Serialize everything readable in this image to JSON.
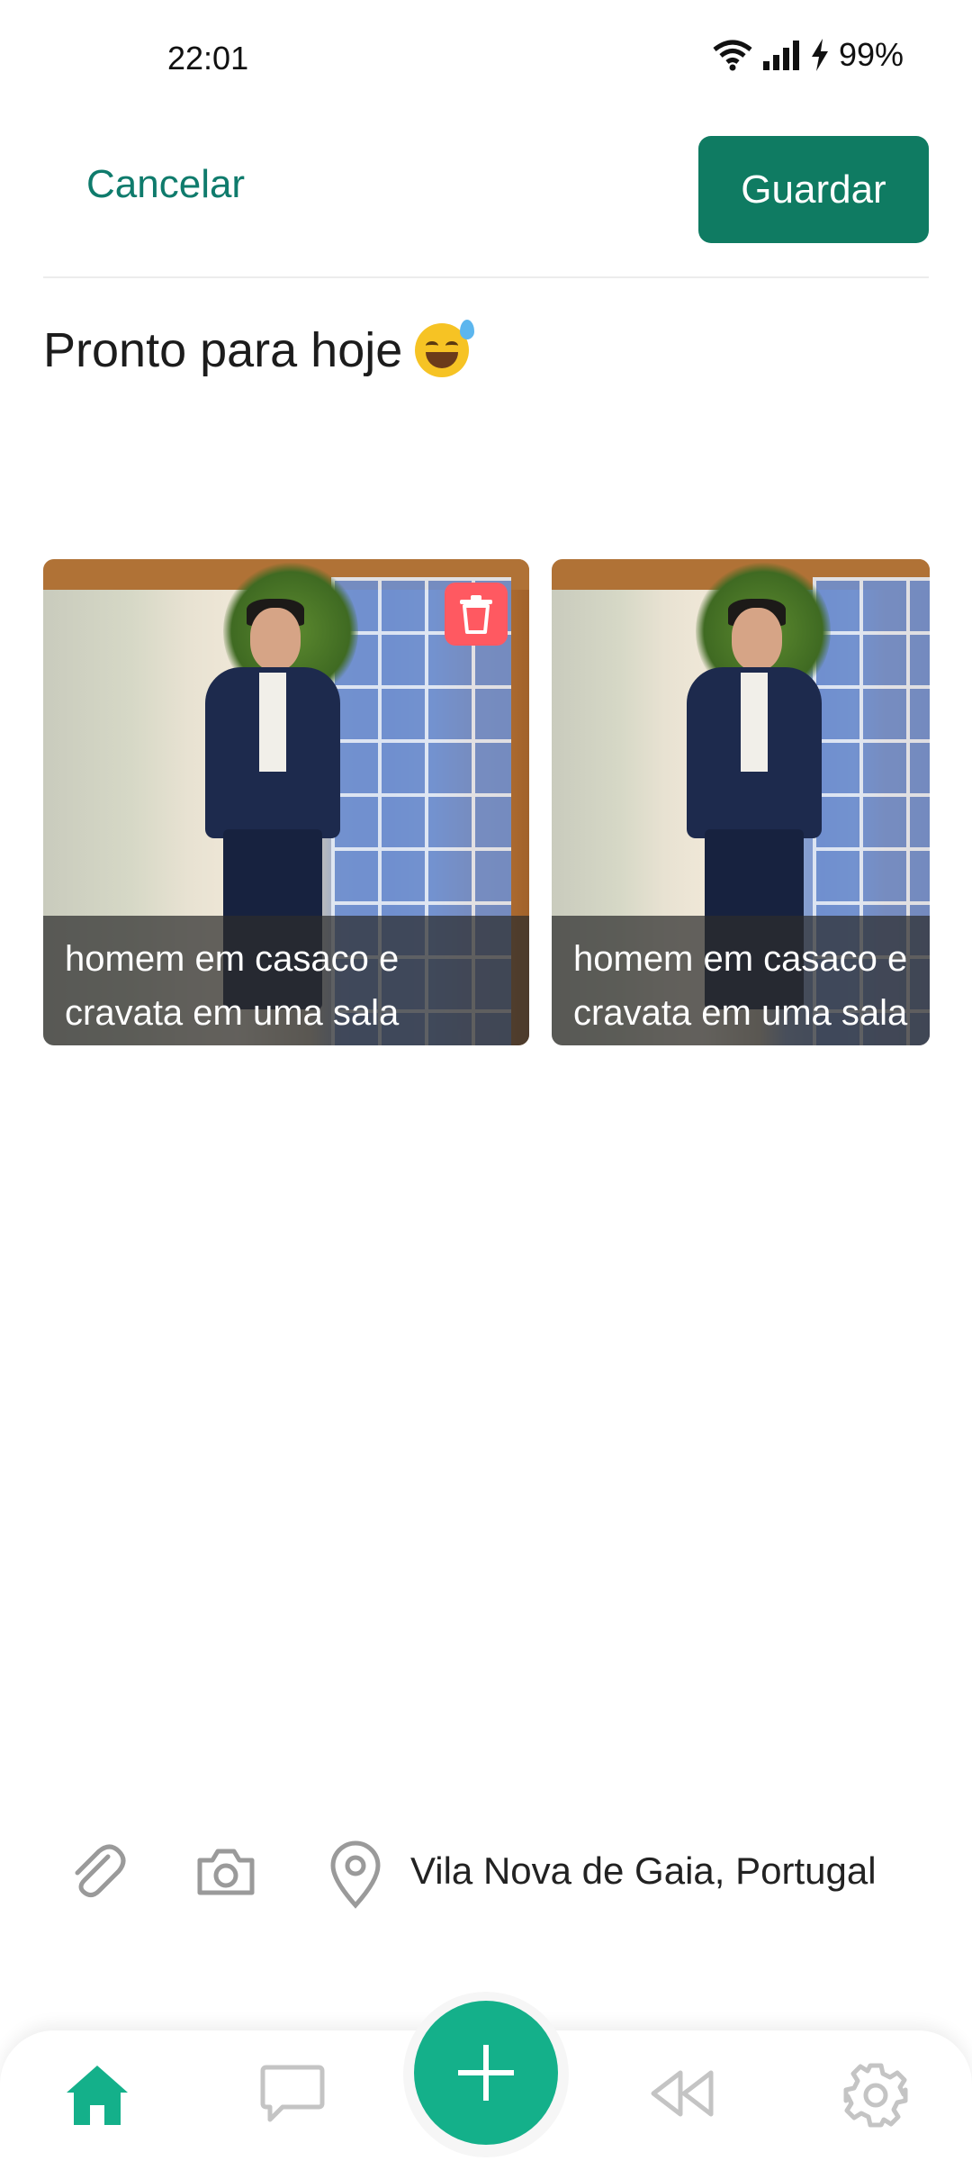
{
  "status_bar": {
    "time": "22:01",
    "battery": "99%"
  },
  "header": {
    "cancel_label": "Cancelar",
    "save_label": "Guardar"
  },
  "post": {
    "text": "Pronto para hoje",
    "emoji_icon": "grinning-sweat-emoji"
  },
  "photos": [
    {
      "caption": "homem em casaco e cravata em uma sala",
      "caption_line1": "homem em casaco e",
      "caption_line2": "cravata em uma sala"
    },
    {
      "caption": "homem em casaco e cravata em uma sala",
      "caption_line1": "homem em casaco e",
      "caption_line2": "cravata em uma sala"
    }
  ],
  "toolbar": {
    "attach_icon": "paperclip-icon",
    "camera_icon": "camera-icon",
    "location_icon": "map-pin-icon",
    "location": "Vila Nova de Gaia, Portugal"
  },
  "bottom_nav": {
    "items": [
      "home-icon",
      "chat-icon",
      "add-icon",
      "rewind-icon",
      "settings-icon"
    ],
    "active": "home-icon"
  },
  "colors": {
    "accent": "#0f7b62",
    "fab": "#14b08a",
    "delete": "#ff5961",
    "inactive_icon": "#c4c4c4"
  }
}
